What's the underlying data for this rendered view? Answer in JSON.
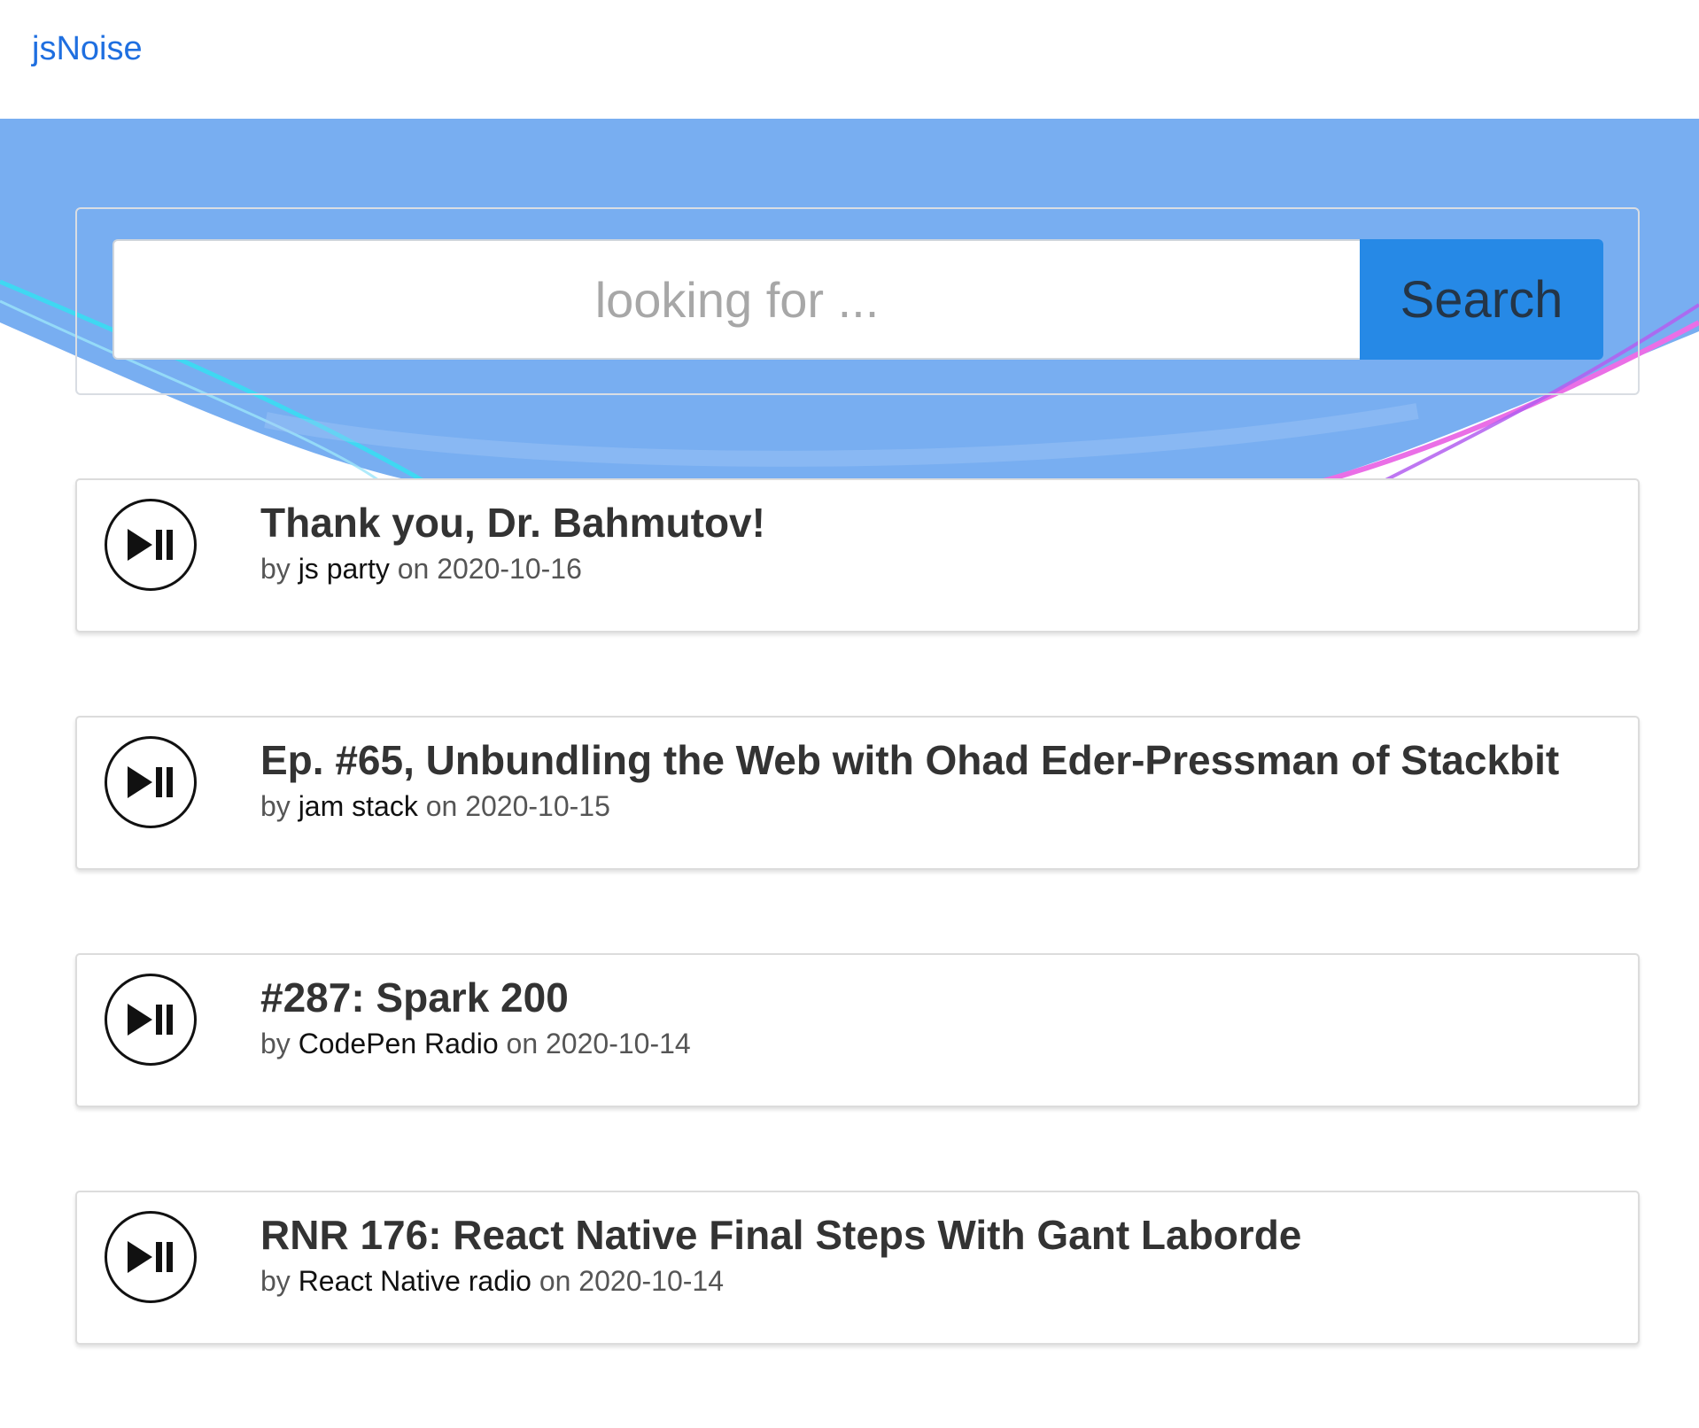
{
  "nav": {
    "brand": "jsNoise"
  },
  "search": {
    "placeholder": "looking for ...",
    "value": "",
    "button_label": "Search"
  },
  "colors": {
    "brand_link": "#1f6fe0",
    "hero_blue": "#78aef1",
    "search_button": "#2689e6",
    "wave_cyan": "#3fd8f2",
    "wave_pink": "#ea6fe6"
  },
  "episodes": [
    {
      "title": "Thank you, Dr. Bahmutov!",
      "by_prefix": "by",
      "author": "js party",
      "date_prefix": "on",
      "date": "2020-10-16",
      "icon": "play-pause-icon"
    },
    {
      "title": "Ep. #65, Unbundling the Web with Ohad Eder-Pressman of Stackbit",
      "by_prefix": "by",
      "author": "jam stack",
      "date_prefix": "on",
      "date": "2020-10-15",
      "icon": "play-pause-icon"
    },
    {
      "title": "#287: Spark 200",
      "by_prefix": "by",
      "author": "CodePen Radio",
      "date_prefix": "on",
      "date": "2020-10-14",
      "icon": "play-pause-icon"
    },
    {
      "title": "RNR 176: React Native Final Steps With Gant Laborde",
      "by_prefix": "by",
      "author": "React Native radio",
      "date_prefix": "on",
      "date": "2020-10-14",
      "icon": "play-pause-icon"
    }
  ]
}
